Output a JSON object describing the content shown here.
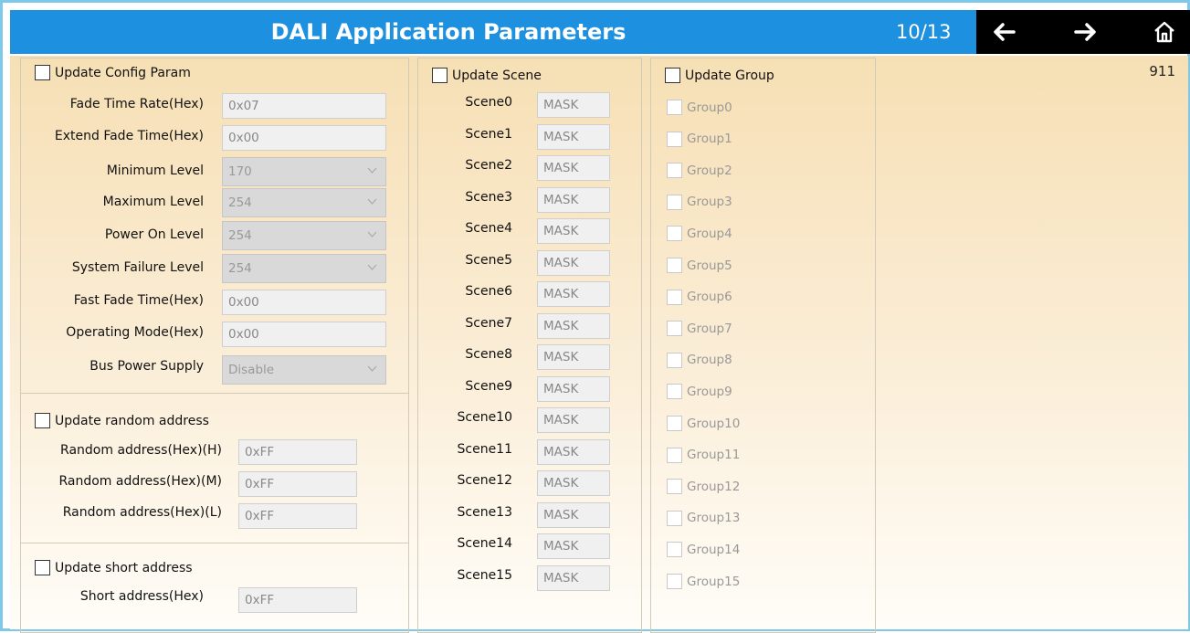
{
  "header": {
    "title": "DALI Application Parameters",
    "page_indicator": "10/13",
    "nav_icons": [
      "arrow-left-icon",
      "arrow-right-icon",
      "home-icon"
    ]
  },
  "corner_value": "911",
  "colors": {
    "title_bar": "#1e90e0",
    "nav_bar": "#000000",
    "border": "#7ec8ea"
  },
  "config": {
    "checkbox_label": "Update Config Param",
    "fields": [
      {
        "label": "Fade Time Rate(Hex)",
        "value": "0x07",
        "kind": "text"
      },
      {
        "label": "Extend Fade Time(Hex)",
        "value": "0x00",
        "kind": "text"
      },
      {
        "label": "Minimum Level",
        "value": "170",
        "kind": "select"
      },
      {
        "label": "Maximum Level",
        "value": "254",
        "kind": "select"
      },
      {
        "label": "Power On Level",
        "value": "254",
        "kind": "select"
      },
      {
        "label": "System Failure Level",
        "value": "254",
        "kind": "select"
      },
      {
        "label": "Fast Fade Time(Hex)",
        "value": "0x00",
        "kind": "text"
      },
      {
        "label": "Operating Mode(Hex)",
        "value": "0x00",
        "kind": "text"
      },
      {
        "label": "Bus Power Supply",
        "value": "Disable",
        "kind": "select"
      }
    ]
  },
  "random_address": {
    "checkbox_label": "Update random address",
    "fields": [
      {
        "label": "Random address(Hex)(H)",
        "value": "0xFF"
      },
      {
        "label": "Random address(Hex)(M)",
        "value": "0xFF"
      },
      {
        "label": "Random address(Hex)(L)",
        "value": "0xFF"
      }
    ]
  },
  "short_address": {
    "checkbox_label": "Update short address",
    "fields": [
      {
        "label": "Short address(Hex)",
        "value": "0xFF"
      }
    ]
  },
  "scene": {
    "checkbox_label": "Update Scene",
    "items": [
      {
        "label": "Scene0",
        "value": "MASK"
      },
      {
        "label": "Scene1",
        "value": "MASK"
      },
      {
        "label": "Scene2",
        "value": "MASK"
      },
      {
        "label": "Scene3",
        "value": "MASK"
      },
      {
        "label": "Scene4",
        "value": "MASK"
      },
      {
        "label": "Scene5",
        "value": "MASK"
      },
      {
        "label": "Scene6",
        "value": "MASK"
      },
      {
        "label": "Scene7",
        "value": "MASK"
      },
      {
        "label": "Scene8",
        "value": "MASK"
      },
      {
        "label": "Scene9",
        "value": "MASK"
      },
      {
        "label": "Scene10",
        "value": "MASK"
      },
      {
        "label": "Scene11",
        "value": "MASK"
      },
      {
        "label": "Scene12",
        "value": "MASK"
      },
      {
        "label": "Scene13",
        "value": "MASK"
      },
      {
        "label": "Scene14",
        "value": "MASK"
      },
      {
        "label": "Scene15",
        "value": "MASK"
      }
    ]
  },
  "group": {
    "checkbox_label": "Update Group",
    "items": [
      "Group0",
      "Group1",
      "Group2",
      "Group3",
      "Group4",
      "Group5",
      "Group6",
      "Group7",
      "Group8",
      "Group9",
      "Group10",
      "Group11",
      "Group12",
      "Group13",
      "Group14",
      "Group15"
    ]
  }
}
